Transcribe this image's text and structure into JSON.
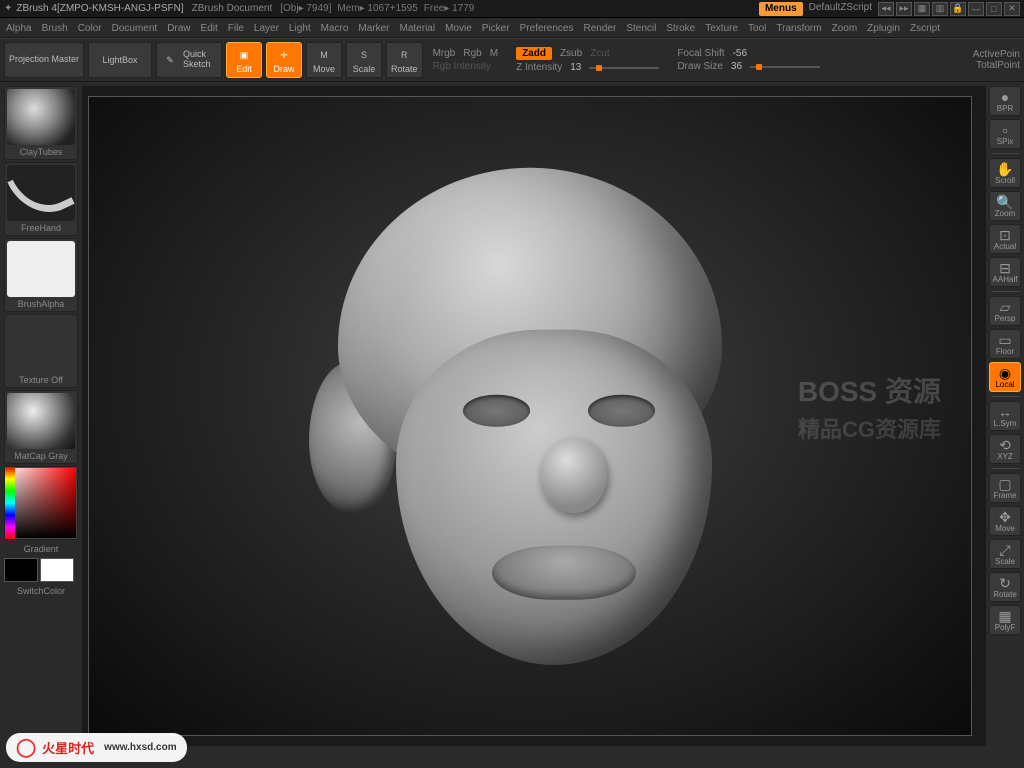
{
  "titlebar": {
    "app": "ZBrush 4[ZMPO-KMSH-ANGJ-PSFN]",
    "doc": "ZBrush Document",
    "obj_label": "[Obj▸ 7949]",
    "mem_label": "Mem▸ 1067+1595",
    "free_label": "Free▸ 1779",
    "menus_btn": "Menus",
    "default_script": "DefaultZScript"
  },
  "menu": [
    "Alpha",
    "Brush",
    "Color",
    "Document",
    "Draw",
    "Edit",
    "File",
    "Layer",
    "Light",
    "Macro",
    "Marker",
    "Material",
    "Movie",
    "Picker",
    "Preferences",
    "Render",
    "Stencil",
    "Stroke",
    "Texture",
    "Tool",
    "Transform",
    "Zoom",
    "Zplugin",
    "Zscript"
  ],
  "toolbar": {
    "projection_master": "Projection Master",
    "lightbox": "LightBox",
    "quick_sketch": "Quick Sketch",
    "edit": "Edit",
    "draw": "Draw",
    "move": "Move",
    "scale": "Scale",
    "rotate": "Rotate",
    "mrgb": "Mrgb",
    "rgb": "Rgb",
    "m": "M",
    "rgb_intensity": "Rgb Intensity",
    "zadd": "Zadd",
    "zsub": "Zsub",
    "zcut": "Zcut",
    "z_intensity_label": "Z Intensity",
    "z_intensity_value": "13",
    "focal_shift_label": "Focal Shift",
    "focal_shift_value": "-56",
    "draw_size_label": "Draw Size",
    "draw_size_value": "36",
    "active_points": "ActivePoin",
    "total_points": "TotalPoint"
  },
  "left_shelf": {
    "brush": "ClayTubes",
    "stroke": "FreeHand",
    "alpha": "BrushAlpha",
    "texture": "Texture Off",
    "material": "MatCap Gray",
    "gradient": "Gradient",
    "switch_color": "SwitchColor"
  },
  "right_shelf": [
    {
      "name": "bpr",
      "label": "BPR"
    },
    {
      "name": "spix",
      "label": "SPix"
    },
    {
      "name": "scroll",
      "label": "Scroll"
    },
    {
      "name": "zoom",
      "label": "Zoom"
    },
    {
      "name": "actual",
      "label": "Actual"
    },
    {
      "name": "aahalf",
      "label": "AAHalf"
    },
    {
      "name": "persp",
      "label": "Persp"
    },
    {
      "name": "floor",
      "label": "Floor"
    },
    {
      "name": "local",
      "label": "Local"
    },
    {
      "name": "lsym",
      "label": "L.Sym"
    },
    {
      "name": "xyz",
      "label": "XYZ"
    },
    {
      "name": "frame",
      "label": "Frame"
    },
    {
      "name": "move",
      "label": "Move"
    },
    {
      "name": "scale",
      "label": "Scale"
    },
    {
      "name": "rotate",
      "label": "Rotate"
    },
    {
      "name": "polyf",
      "label": "PolyF"
    }
  ],
  "watermark": {
    "line1": "BOSS 资源",
    "line2": "精品CG资源库"
  },
  "site_watermark": {
    "text": "火星时代",
    "url": "www.hxsd.com"
  }
}
